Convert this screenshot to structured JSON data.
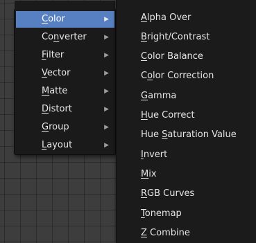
{
  "categories": [
    {
      "pre": "",
      "u": "C",
      "post": "olor"
    },
    {
      "pre": "Co",
      "u": "n",
      "post": "verter"
    },
    {
      "pre": "",
      "u": "F",
      "post": "ilter"
    },
    {
      "pre": "",
      "u": "V",
      "post": "ector"
    },
    {
      "pre": "",
      "u": "M",
      "post": "atte"
    },
    {
      "pre": "",
      "u": "D",
      "post": "istort"
    },
    {
      "pre": "",
      "u": "G",
      "post": "roup"
    },
    {
      "pre": "",
      "u": "L",
      "post": "ayout"
    }
  ],
  "submenu": [
    {
      "pre": "",
      "u": "A",
      "post": "lpha Over"
    },
    {
      "pre": "",
      "u": "B",
      "post": "right/Contrast"
    },
    {
      "pre": "",
      "u": "C",
      "post": "olor Balance"
    },
    {
      "pre": "C",
      "u": "o",
      "post": "lor Correction"
    },
    {
      "pre": "",
      "u": "G",
      "post": "amma"
    },
    {
      "pre": "",
      "u": "H",
      "post": "ue Correct"
    },
    {
      "pre": "Hue ",
      "u": "S",
      "post": "aturation Value"
    },
    {
      "pre": "",
      "u": "I",
      "post": "nvert"
    },
    {
      "pre": "",
      "u": "M",
      "post": "ix"
    },
    {
      "pre": "",
      "u": "R",
      "post": "GB Curves"
    },
    {
      "pre": "",
      "u": "T",
      "post": "onemap"
    },
    {
      "pre": "",
      "u": "Z",
      "post": " Combine"
    }
  ]
}
